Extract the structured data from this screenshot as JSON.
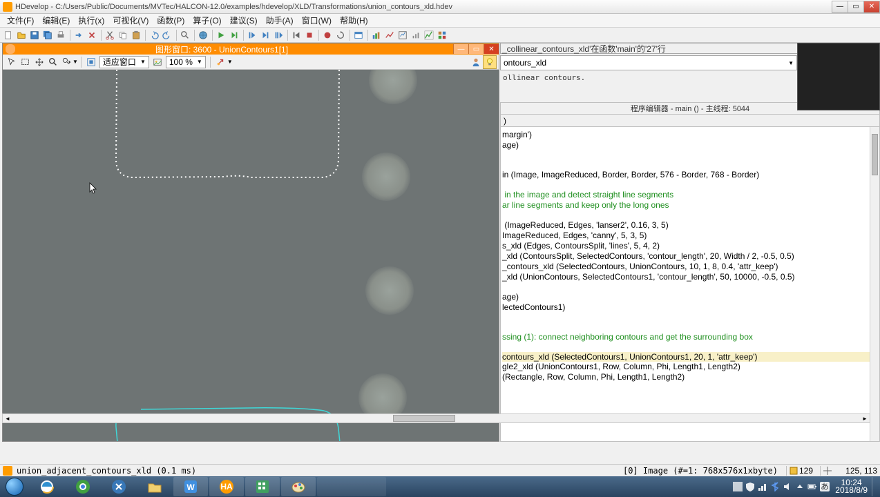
{
  "title": "HDevelop - C:/Users/Public/Documents/MVTec/HALCON-12.0/examples/hdevelop/XLD/Transformations/union_contours_xld.hdev",
  "menu": {
    "file": "文件(F)",
    "edit": "编辑(E)",
    "exec": "执行(x)",
    "vis": "可视化(V)",
    "func": "函数(P)",
    "op": "算子(O)",
    "sugg": "建议(S)",
    "asst": "助手(A)",
    "win": "窗口(W)",
    "help": "帮助(H)"
  },
  "gfx": {
    "title": "图形窗口: 3600 - UnionContours1[1]",
    "fit": "适应窗口",
    "zoom": "100 %"
  },
  "right": {
    "header": "_collinear_contours_xld'在函数'main'的'27'行",
    "combo": "ontours_xld",
    "desc": "ollinear contours.",
    "editor_title": "程序编辑器 - main () - 主线程: 5044",
    "paren": ")"
  },
  "code": {
    "l1": "margin')",
    "l2": "age)",
    "l3": "in (Image, ImageReduced, Border, Border, 576 - Border, 768 - Border)",
    "l4": " in the image and detect straight line segments",
    "l5": "ar line segments and keep only the long ones",
    "l6": " (ImageReduced, Edges, 'lanser2', 0.16, 3, 5)",
    "l7": "ImageReduced, Edges, 'canny', 5, 3, 5)",
    "l8": "s_xld (Edges, ContoursSplit, 'lines', 5, 4, 2)",
    "l9": "_xld (ContoursSplit, SelectedContours, 'contour_length', 20, Width / 2, -0.5, 0.5)",
    "l10": "_contours_xld (SelectedContours, UnionContours, 10, 1, 8, 0.4, 'attr_keep')",
    "l11": "_xld (UnionContours, SelectedContours1, 'contour_length', 50, 10000, -0.5, 0.5)",
    "l12": "age)",
    "l13": "lectedContours1)",
    "l14": "ssing (1): connect neighboring contours and get the surrounding box",
    "l15": "contours_xld (SelectedContours1, UnionContours1, 20, 1, 'attr_keep')",
    "l16": "gle2_xld (UnionContours1, Row, Column, Phi, Length1, Length2)",
    "l17": "(Rectangle, Row, Column, Phi, Length1, Length2)"
  },
  "status": {
    "op": "union_adjacent_contours_xld (0.1 ms)",
    "img": "[0] Image (#=1: 768x576x1xbyte)",
    "gray": "129",
    "coord": "125, 113"
  },
  "clock": {
    "time": "10:24",
    "date": "2018/8/9"
  }
}
